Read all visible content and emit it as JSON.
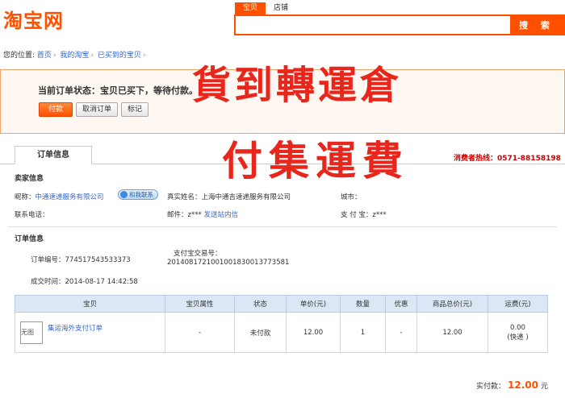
{
  "header": {
    "logo_text": "淘宝网",
    "search_tabs": [
      {
        "label": "宝贝",
        "active": true
      },
      {
        "label": "店铺",
        "active": false
      }
    ],
    "search_placeholder": "",
    "search_button": "搜 索"
  },
  "breadcrumb": {
    "prefix": "您的位置:",
    "items": [
      "首页",
      "我的淘宝",
      "已买到的宝贝"
    ]
  },
  "status": {
    "text": "当前订单状态：宝贝已买下，等待付款。",
    "buttons": {
      "pay": "付款",
      "cancel": "取消订单",
      "mark": "标记"
    }
  },
  "overlay": {
    "line1": "貨到轉運倉",
    "line2": "付集運費"
  },
  "tab": {
    "label": "订单信息"
  },
  "hotline": "消费者热线：0571-88158198",
  "seller": {
    "section_title": "卖家信息",
    "nickname_label": "昵称：",
    "nickname": "中通速递服务有限公司",
    "contact_badge": "和我联系",
    "realname_label": "真实姓名：",
    "realname": "上海中通吉速递服务有限公司",
    "city_label": "城市：",
    "city": "",
    "phone_label": "联系电话：",
    "phone": "",
    "email_label": "邮件：",
    "email": "z*** ",
    "email_link": "发送站内信",
    "alipay_label": "支 付 宝：",
    "alipay": "z***"
  },
  "order": {
    "section_title": "订单信息",
    "order_no_label": "订单编号：",
    "order_no": "774517543533373",
    "alipay_trade_label": "支付宝交易号：",
    "alipay_trade_no": "2014081721001001830013773581",
    "time_label": "成交时间：",
    "time": "2014-08-17 14:42:58"
  },
  "table": {
    "headers": [
      "宝贝",
      "宝贝属性",
      "状态",
      "单价(元)",
      "数量",
      "优惠",
      "商品总价(元)",
      "运费(元)"
    ],
    "rows": [
      {
        "thumb": "无图",
        "name": "集运海外支付订单",
        "attrs": "-",
        "status": "未付款",
        "price": "12.00",
        "qty": "1",
        "discount": "-",
        "total": "12.00",
        "shipping": "0.00",
        "shipping_note": "(快递 )"
      }
    ]
  },
  "summary": {
    "label": "实付款：",
    "amount": "12.00",
    "unit": "元"
  },
  "colors": {
    "brand": "#ff5000",
    "overlay_red": "#e8261c",
    "link": "#3366cc"
  }
}
